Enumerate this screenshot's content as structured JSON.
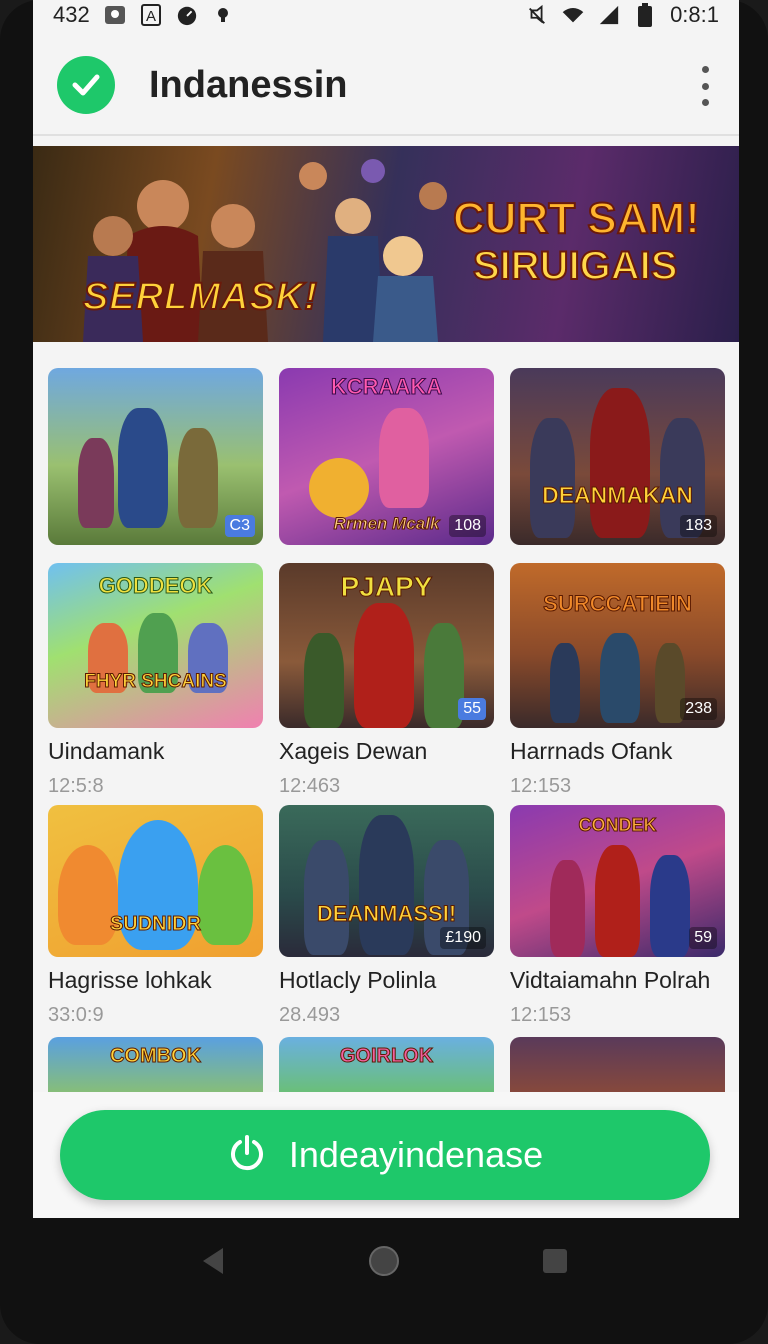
{
  "status_bar": {
    "left_text": "432",
    "time": "0:8:1",
    "icons": [
      "image-icon",
      "text-icon",
      "timer-icon",
      "dot-icon",
      "mute-icon",
      "wifi-icon",
      "signal-icon",
      "battery-icon"
    ]
  },
  "app_bar": {
    "title": "Indanessin",
    "logo_icon": "check-icon",
    "menu_icon": "more-vert-icon"
  },
  "banner": {
    "left_text": "SERLMASK!",
    "right_line1": "CURT SAM!",
    "right_line2": "SIRUIGAIS"
  },
  "cards": [
    {
      "art_text": "",
      "badge": "C3",
      "title": "",
      "sub": ""
    },
    {
      "art_text": "KCRAAKA",
      "art_sub": "Rrmen Mcalk",
      "badge": "108",
      "title": "",
      "sub": ""
    },
    {
      "art_text": "DEANMAKAN",
      "badge": "183",
      "title": "",
      "sub": ""
    },
    {
      "art_text": "GODDEOK",
      "art_sub": "FHYR SHCAINS",
      "badge": "",
      "title": "Uindamank",
      "sub": "12:5:8"
    },
    {
      "art_text": "PJAPY",
      "badge": "55",
      "title": "Xageis Dewan",
      "sub": "12:463"
    },
    {
      "art_text": "SURCCATIEIN",
      "badge": "238",
      "title": "Harrnads Ofank",
      "sub": "12:153"
    },
    {
      "art_text": "SUDNIDR",
      "badge": "",
      "title": "Hagrisse lohkak",
      "sub": "33:0:9"
    },
    {
      "art_text": "DEANMASSI!",
      "badge": "£190",
      "title": "Hotlacly Polinla",
      "sub": "28.493"
    },
    {
      "art_text": "CONDEK",
      "badge": "59",
      "title": "Vidtaiamahn Polrah",
      "sub": "12:153"
    },
    {
      "art_text": "COMBOK",
      "badge": "",
      "title": "",
      "sub": ""
    },
    {
      "art_text": "GOIRLOK",
      "badge": "",
      "title": "",
      "sub": ""
    },
    {
      "art_text": "",
      "badge": "",
      "title": "",
      "sub": ""
    }
  ],
  "cta": {
    "label": "Indeayindenase",
    "icon": "power-icon"
  },
  "nav": {
    "icons": [
      "back-icon",
      "home-icon",
      "recents-icon"
    ]
  },
  "colors": {
    "accent": "#1ec86a",
    "text": "#222222",
    "subtext": "#999999"
  }
}
